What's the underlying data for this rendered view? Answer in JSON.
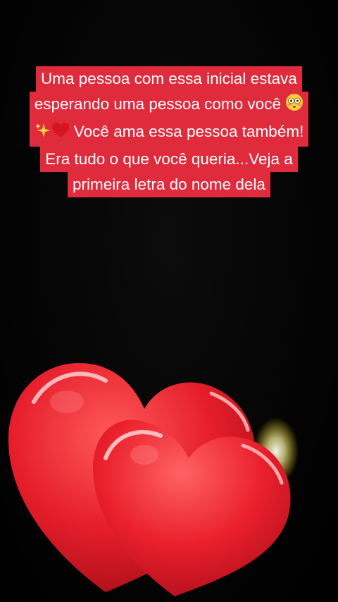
{
  "caption": {
    "line1": "Uma pessoa com essa inicial estava",
    "line2_text": "esperando uma pessoa como você",
    "line2_emoji": "flushed-face-icon",
    "line3_emoji_1": "sparkles-icon",
    "line3_emoji_2": "red-heart-icon",
    "line3_text": "Você ama essa pessoa também!",
    "line4": "Era tudo o que você queria...Veja a",
    "line5": "primeira letra do nome dela"
  },
  "colors": {
    "background": "#050505",
    "caption_highlight": "#df2b3c",
    "caption_text": "#ffffff",
    "heart_red": "#e8202e",
    "heart_shadow": "#a3101a"
  },
  "image": {
    "subject": "two-red-hearts-icon"
  }
}
